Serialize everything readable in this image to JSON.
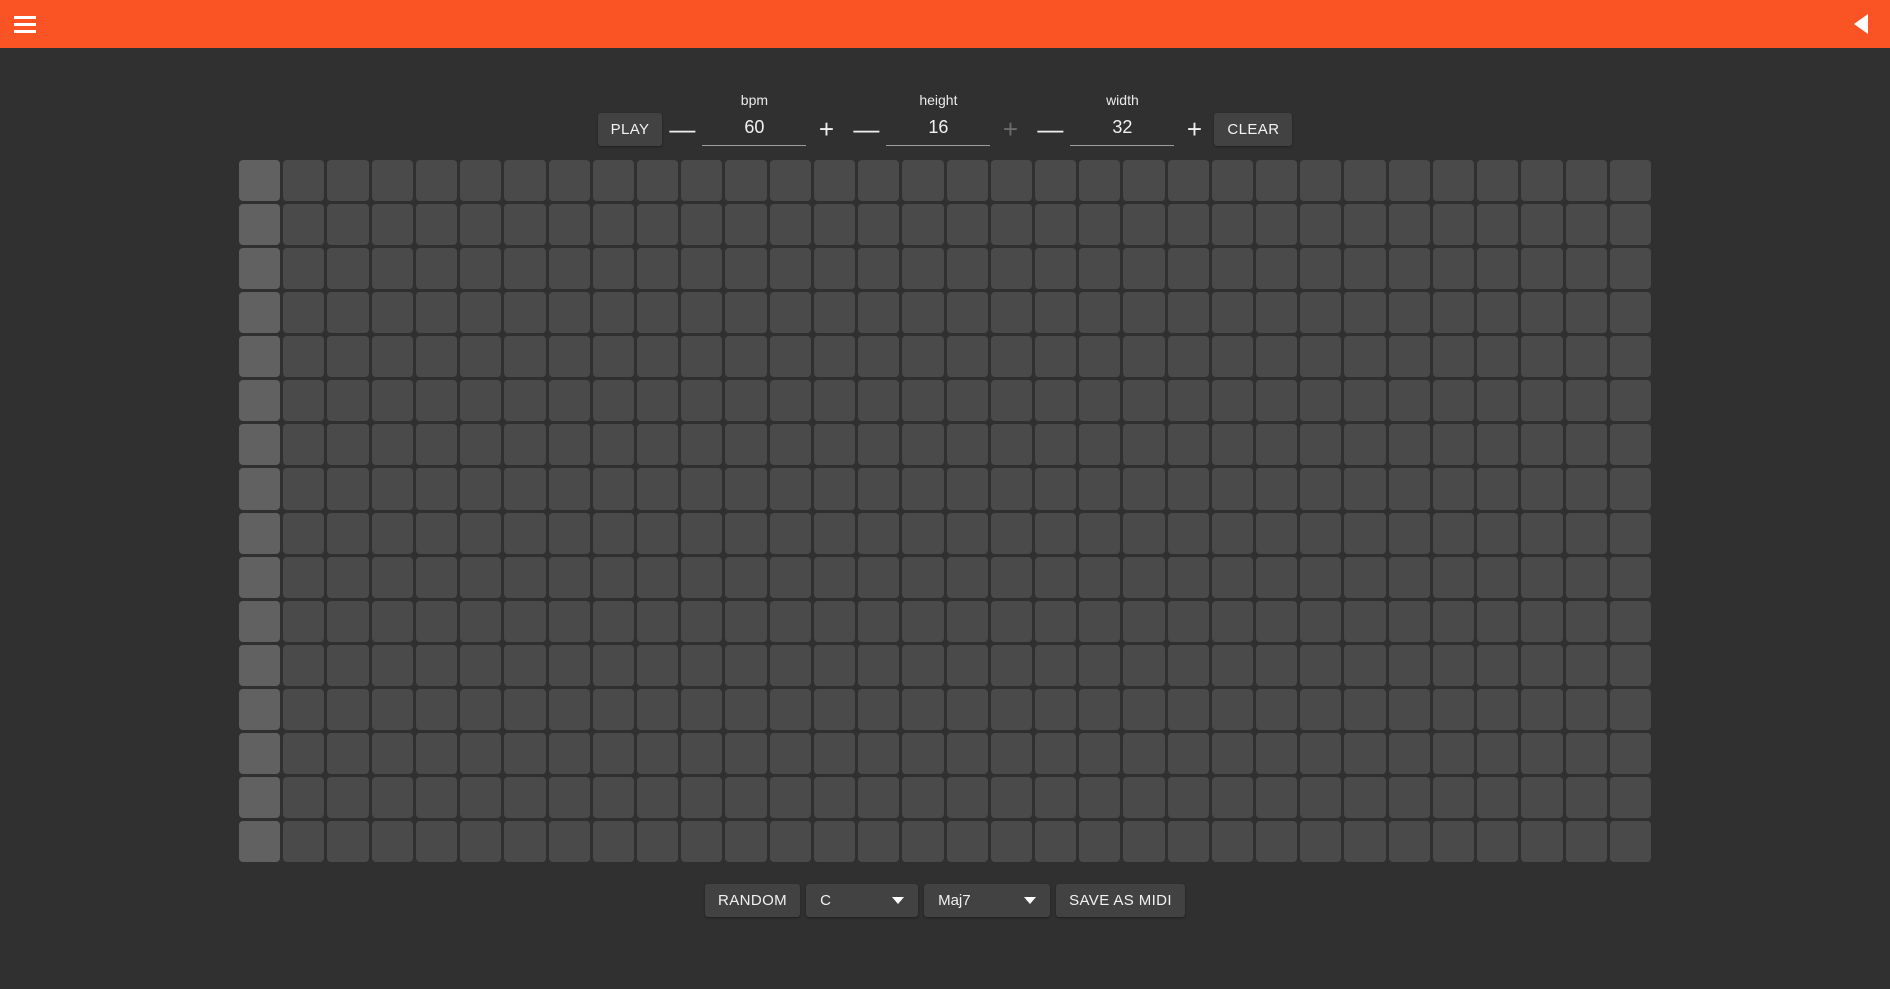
{
  "header": {
    "menu_icon": "hamburger-icon",
    "back_icon": "left-triangle-icon",
    "accent_color": "#fa5424"
  },
  "toolbar": {
    "play_label": "PLAY",
    "clear_label": "CLEAR",
    "minus_label": "—",
    "plus_label": "+",
    "fields": [
      {
        "label": "bpm",
        "value": "60",
        "plus_disabled": false
      },
      {
        "label": "height",
        "value": "16",
        "plus_disabled": true
      },
      {
        "label": "width",
        "value": "32",
        "plus_disabled": false
      }
    ]
  },
  "grid": {
    "columns": 32,
    "rows": 16,
    "accent_column": 1,
    "cell_color": "#4a4a4a",
    "accent_cell_color": "#616161",
    "active_cell_color": "#fa5424",
    "active_cells": []
  },
  "bottom_toolbar": {
    "random_label": "RANDOM",
    "save_label": "SAVE AS MIDI",
    "key_select": {
      "value": "C"
    },
    "chord_select": {
      "value": "Maj7"
    }
  },
  "theme": {
    "background": "#303030",
    "surface": "#424242",
    "text": "#f2f2f2"
  }
}
